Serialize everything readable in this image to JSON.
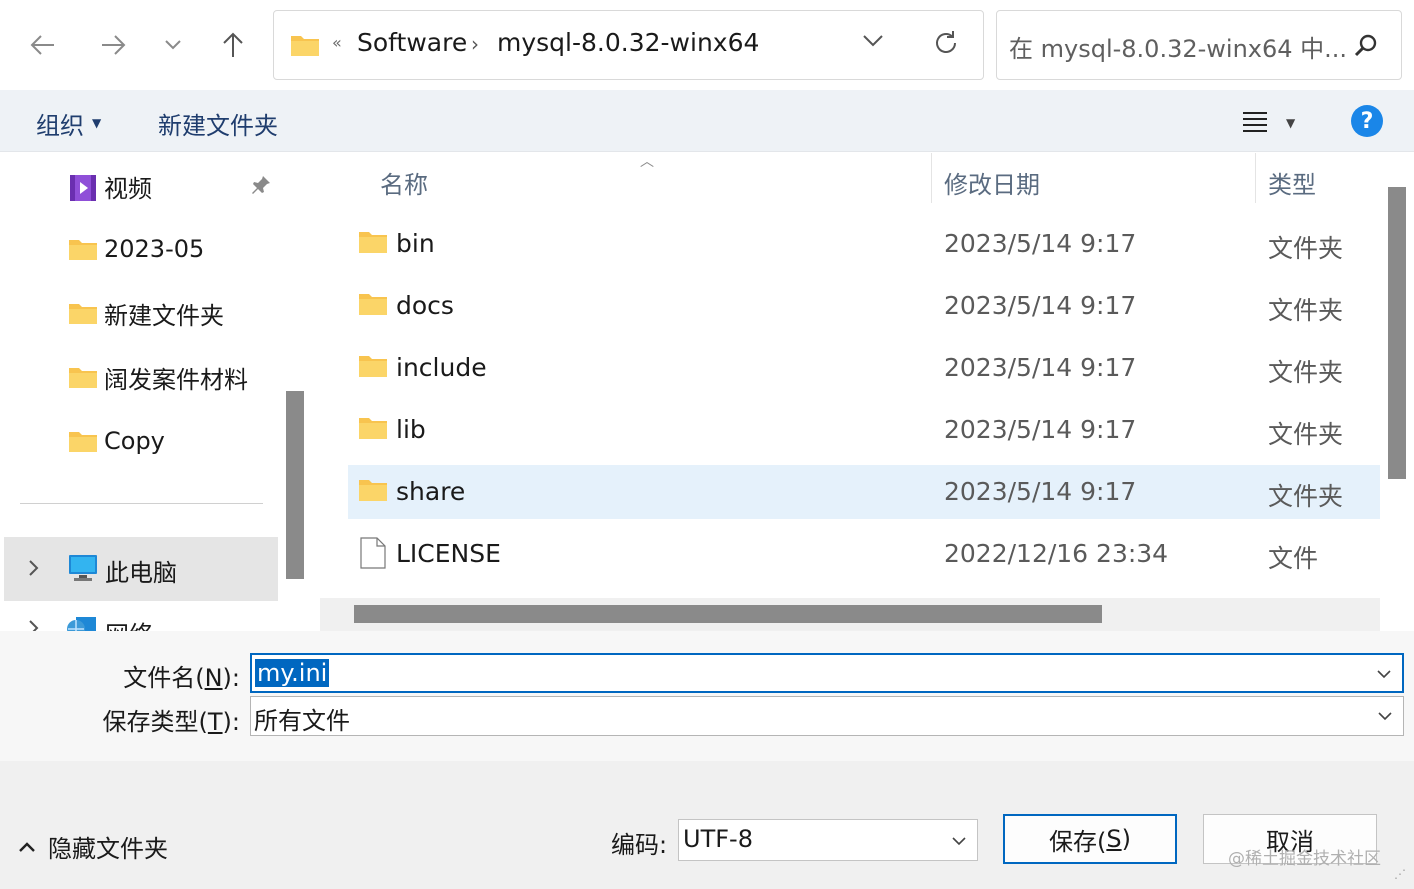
{
  "address": {
    "overflow": "«",
    "crumbs": [
      "Software",
      "mysql-8.0.32-winx64"
    ],
    "separator": "›"
  },
  "search": {
    "placeholder": "在 mysql-8.0.32-winx64 中..."
  },
  "toolbar": {
    "organize": "组织",
    "new_folder": "新建文件夹",
    "help": "?"
  },
  "nav": {
    "items": [
      {
        "label": "视频",
        "icon": "video-folder-icon",
        "pinned": true
      },
      {
        "label": "2023-05",
        "icon": "folder-icon"
      },
      {
        "label": "新建文件夹",
        "icon": "folder-icon"
      },
      {
        "label": "阔发案件材料",
        "icon": "folder-icon"
      },
      {
        "label": "Copy",
        "icon": "folder-icon"
      }
    ],
    "this_pc": "此电脑",
    "network": "网络"
  },
  "columns": {
    "name": "名称",
    "modified": "修改日期",
    "type": "类型"
  },
  "files": [
    {
      "name": "bin",
      "modified": "2023/5/14 9:17",
      "type": "文件夹",
      "icon": "folder-icon"
    },
    {
      "name": "docs",
      "modified": "2023/5/14 9:17",
      "type": "文件夹",
      "icon": "folder-icon"
    },
    {
      "name": "include",
      "modified": "2023/5/14 9:17",
      "type": "文件夹",
      "icon": "folder-icon"
    },
    {
      "name": "lib",
      "modified": "2023/5/14 9:17",
      "type": "文件夹",
      "icon": "folder-icon"
    },
    {
      "name": "share",
      "modified": "2023/5/14 9:17",
      "type": "文件夹",
      "icon": "folder-icon",
      "selected": true
    },
    {
      "name": "LICENSE",
      "modified": "2022/12/16 23:34",
      "type": "文件",
      "icon": "file-icon"
    }
  ],
  "filename": {
    "label_pre": "文件名(",
    "label_key": "N",
    "label_post": "):",
    "value": "my.ini"
  },
  "savetype": {
    "label_pre": "保存类型(",
    "label_key": "T",
    "label_post": "):",
    "value": "所有文件"
  },
  "bottom": {
    "hide_folders": "隐藏文件夹",
    "encoding_label": "编码:",
    "encoding_value": "UTF-8",
    "save_pre": "保存(",
    "save_key": "S",
    "save_post": ")",
    "cancel": "取消",
    "watermark": "@稀土掘金技术社区"
  },
  "colors": {
    "accent": "#0067c0",
    "selection_row": "#e5f1fb",
    "folder_yellow": "#f8c44f",
    "help_blue": "#1a86e8"
  }
}
